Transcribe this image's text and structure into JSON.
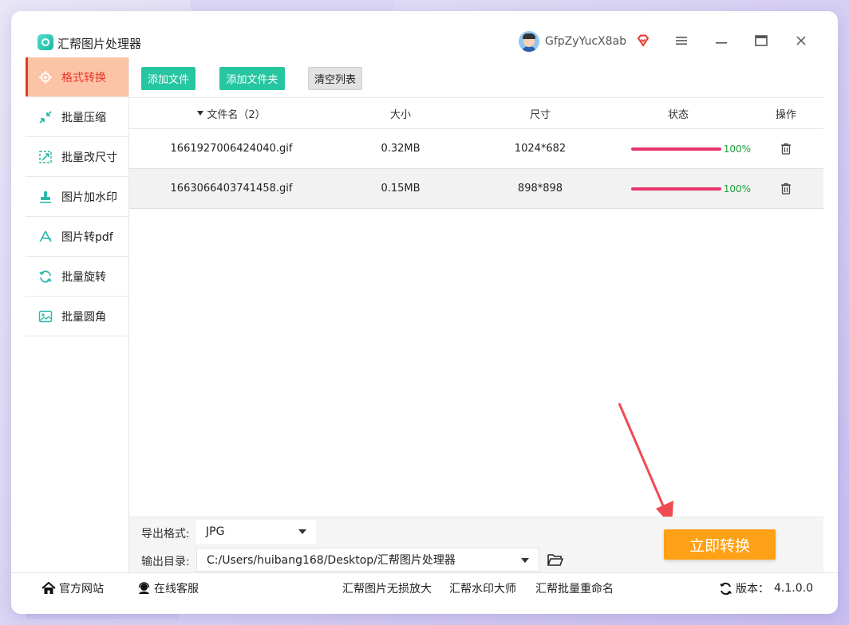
{
  "app": {
    "title": "汇帮图片处理器",
    "username": "GfpZyYucX8ab"
  },
  "colors": {
    "accent_green": "#25c6a0",
    "active_bg": "#fcc4a7",
    "active_text": "#e8362b",
    "progress": "#e8356c",
    "convert": "#ffa116"
  },
  "sidebar": {
    "items": [
      {
        "label": "格式转换",
        "icon": "gear-icon"
      },
      {
        "label": "批量压缩",
        "icon": "compress-icon"
      },
      {
        "label": "批量改尺寸",
        "icon": "resize-icon"
      },
      {
        "label": "图片加水印",
        "icon": "stamp-icon"
      },
      {
        "label": "图片转pdf",
        "icon": "pdf-icon"
      },
      {
        "label": "批量旋转",
        "icon": "rotate-icon"
      },
      {
        "label": "批量圆角",
        "icon": "image-icon"
      }
    ]
  },
  "toolbar": {
    "add_file": "添加文件",
    "add_folder": "添加文件夹",
    "clear_list": "清空列表"
  },
  "table": {
    "headers": {
      "name": "文件名（2）",
      "size": "大小",
      "dimensions": "尺寸",
      "status": "状态",
      "action": "操作"
    },
    "rows": [
      {
        "name": "1661927006424040.gif",
        "size": "0.32MB",
        "dimensions": "1024*682",
        "progress": "100%"
      },
      {
        "name": "1663066403741458.gif",
        "size": "0.15MB",
        "dimensions": "898*898",
        "progress": "100%"
      }
    ]
  },
  "bottom": {
    "format_label": "导出格式:",
    "format_value": "JPG",
    "dir_label": "输出目录:",
    "dir_value": "C:/Users/huibang168/Desktop/汇帮图片处理器",
    "convert_label": "立即转换"
  },
  "footer": {
    "website": "官方网站",
    "support": "在线客服",
    "link1": "汇帮图片无损放大",
    "link2": "汇帮水印大师",
    "link3": "汇帮批量重命名",
    "version_label": "版本：",
    "version_value": "4.1.0.0"
  }
}
